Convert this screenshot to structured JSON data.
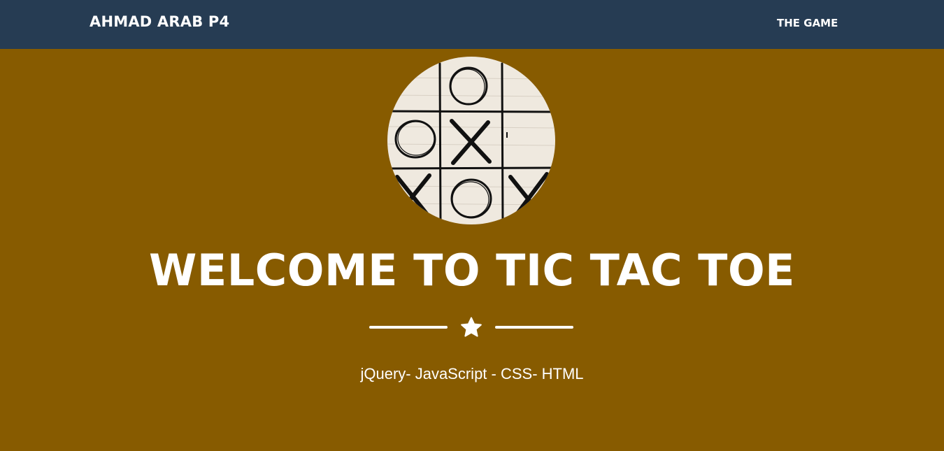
{
  "navbar": {
    "brand": "AHMAD ARAB P4",
    "link_the_game": "THE GAME",
    "background_color": "#263c53"
  },
  "masthead": {
    "background_color": "#875b00",
    "title": "WELCOME TO TIC TAC TOE",
    "subtitle": "jQuery- JavaScript - CSS- HTML",
    "divider_icon": "star-icon",
    "image_icon": "tic-tac-toe-board-image"
  }
}
